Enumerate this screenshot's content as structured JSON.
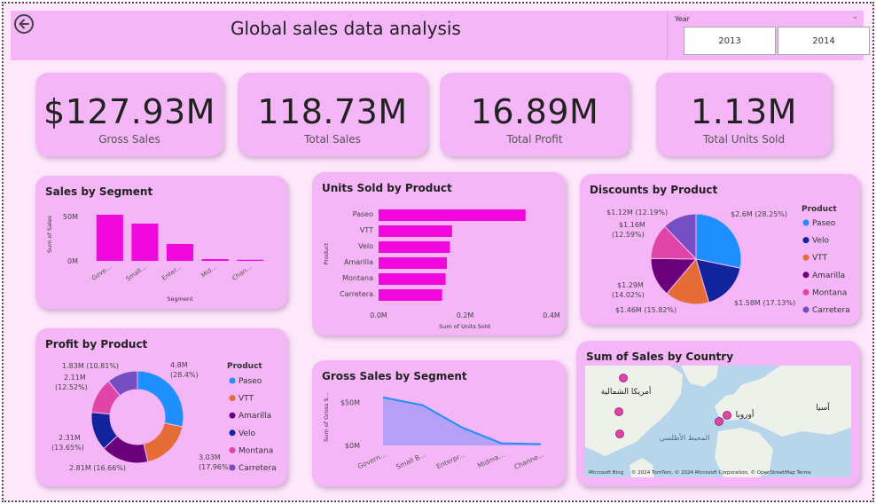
{
  "header": {
    "title": "Global sales data analysis",
    "slicer_label": "Year",
    "years": [
      "2013",
      "2014"
    ]
  },
  "kpis": [
    {
      "value": "$127.93M",
      "label": "Gross Sales"
    },
    {
      "value": "118.73M",
      "label": "Total Sales"
    },
    {
      "value": "16.89M",
      "label": "Total Profit"
    },
    {
      "value": "1.13M",
      "label": "Total Units Sold"
    }
  ],
  "colors": {
    "magenta": "#f008dc",
    "paseo": "#1f8fff",
    "velo": "#12239e",
    "vtt": "#e66c37",
    "amarilla": "#6b007b",
    "montana": "#e044a7",
    "carretera": "#744ec2",
    "area_line": "#1f8fff",
    "area_fill": "#a89cf5"
  },
  "sales_by_segment": {
    "title": "Sales by Segment",
    "chart_data": {
      "type": "bar",
      "categories": [
        "Gove...",
        "Small...",
        "Enter...",
        "Mid...",
        "Chan..."
      ],
      "values": [
        52,
        42,
        19,
        2,
        1.2
      ],
      "ylim": [
        0,
        60
      ],
      "ytick_values": [
        0,
        50
      ],
      "ytick_labels": [
        "0M",
        "50M"
      ],
      "xlabel": "Segment",
      "ylabel": "Sum of Sales"
    }
  },
  "units_by_product": {
    "title": "Units Sold by Product",
    "chart_data": {
      "type": "bar",
      "orientation": "horizontal",
      "categories": [
        "Paseo",
        "VTT",
        "Velo",
        "Amarilla",
        "Montana",
        "Carretera"
      ],
      "values": [
        0.34,
        0.17,
        0.165,
        0.158,
        0.155,
        0.147
      ],
      "xlim": [
        0,
        0.4
      ],
      "xtick_values": [
        0,
        0.2,
        0.4
      ],
      "xtick_labels": [
        "0.0M",
        "0.2M",
        "0.4M"
      ],
      "xlabel": "Sum of Units Sold",
      "ylabel": "Product"
    }
  },
  "discounts_by_product": {
    "title": "Discounts by Product",
    "legend_title": "Product",
    "chart_data": {
      "type": "pie",
      "categories": [
        "Paseo",
        "Velo",
        "VTT",
        "Amarilla",
        "Montana",
        "Carretera"
      ],
      "values": [
        2.6,
        1.58,
        1.46,
        1.29,
        1.16,
        1.12
      ],
      "labels": [
        "$2.6M (28.25%)",
        "$1.58M (17.13%)",
        "$1.46M (15.82%)",
        "$1.29M (14.02%)",
        "$1.16M (12.59%)",
        "$1.12M (12.19%)"
      ]
    }
  },
  "profit_by_product": {
    "title": "Profit by Product",
    "legend_title": "Product",
    "legend": [
      "Paseo",
      "VTT",
      "Amarilla",
      "Velo",
      "Montana",
      "Carretera"
    ],
    "chart_data": {
      "type": "donut",
      "categories": [
        "Paseo",
        "VTT",
        "Amarilla",
        "Velo",
        "Montana",
        "Carretera"
      ],
      "values": [
        4.8,
        3.03,
        2.81,
        2.31,
        2.11,
        1.83
      ],
      "labels": [
        "4.8M (28.4%)",
        "3.03M (17.96%)",
        "2.81M (16.66%)",
        "2.31M (13.65%)",
        "2.11M (12.52%)",
        "1.83M (10.81%)"
      ]
    }
  },
  "gross_sales_by_segment": {
    "title": "Gross Sales by Segment",
    "chart_data": {
      "type": "area",
      "categories": [
        "Govern...",
        "Small B...",
        "Enterpr...",
        "Midma...",
        "Channe..."
      ],
      "values": [
        56,
        47,
        21,
        2.5,
        1.5
      ],
      "ylim": [
        0,
        60
      ],
      "ytick_values": [
        0,
        50
      ],
      "ytick_labels": [
        "$0M",
        "$50M"
      ],
      "ylabel": "Sum of Gross S..."
    }
  },
  "map": {
    "title": "Sum of Sales by Country",
    "labels": {
      "na": "أمريكا الشمالية",
      "eu": "أوروبا",
      "asia": "آسيا",
      "ocean": "المحيط الأطلسي"
    },
    "attribution": "© 2024 TomTom, © 2024 Microsoft Corporation, © OpenStreetMap Terms",
    "brand": "Microsoft Bing"
  }
}
